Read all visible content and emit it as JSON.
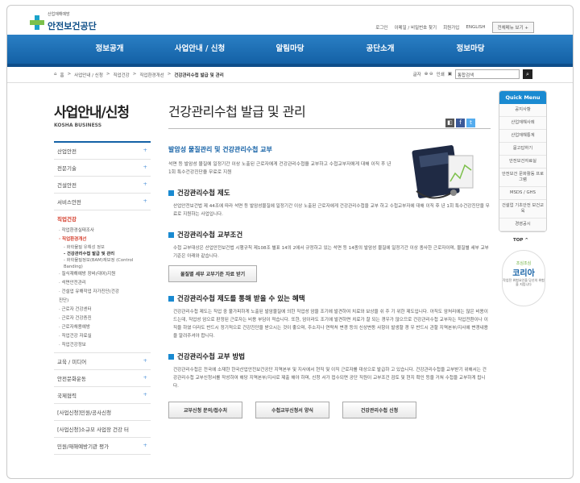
{
  "header": {
    "logo_small": "산업재해예방",
    "logo_name": "안전보건공단",
    "utils": [
      "로그인",
      "이메일 / 비밀번호 찾기",
      "회원가입",
      "ENGLISH"
    ],
    "all_menu": "전체메뉴 보기 +"
  },
  "gnb": [
    "정보공개",
    "사업안내 / 신청",
    "알림마당",
    "공단소개",
    "정보마당"
  ],
  "breadcrumb": {
    "items": [
      "홈",
      "사업안내 / 신청",
      "직업건강",
      "직업환경개선"
    ],
    "current": "건강관리수첩 발급 및 관리"
  },
  "locbar": {
    "print": "글자",
    "print_sym": "⊕ ⊖",
    "print2": "인쇄",
    "search_placeholder": "통합검색"
  },
  "sidebar": {
    "title": "사업안내/신청",
    "subtitle": "KOSHA BUSINESS",
    "items": [
      {
        "label": "산업안전",
        "plus": "+"
      },
      {
        "label": "전문기술",
        "plus": "+"
      },
      {
        "label": "건설안전",
        "plus": "+"
      },
      {
        "label": "서비스안전",
        "plus": "+"
      }
    ],
    "active": "직업건강",
    "subs": [
      {
        "label": "· 작업환경실태조사",
        "cls": ""
      },
      {
        "label": "· 직업환경개선",
        "cls": "red"
      }
    ],
    "subsubs": [
      {
        "label": "- 화학물질 유해성 정보",
        "cls": ""
      },
      {
        "label": "- 건강관리수첩 발급 및 관리",
        "cls": "cur"
      },
      {
        "label": "- 화학물질정보(BAM)재보정 (Control",
        "cls": ""
      },
      {
        "label": "Banding)",
        "cls": ""
      }
    ],
    "subs2": [
      "· 질식재해예방 장비(대여)지원",
      "· 석면안전관리",
      "· 건설업 유해작업 자가진단(건강",
      "  진단)",
      "· 근로자 건강센터",
      "· 근로자 건강증진",
      "· 근로자채용예방",
      "· 직업건강 자료실",
      "· 직업건강정보"
    ],
    "items2": [
      {
        "label": "교육 / 미디어",
        "plus": "+"
      },
      {
        "label": "안전문화운동",
        "plus": "+"
      },
      {
        "label": "국제협력",
        "plus": "+"
      },
      {
        "label": "[사업신청]민원/공사신청",
        "plus": ""
      },
      {
        "label": "[사업신청]소규모 사업장 건강 터",
        "plus": ""
      },
      {
        "label": "민원/재해예방기관 평가",
        "plus": "+"
      }
    ]
  },
  "content": {
    "title": "건강관리수첩 발급 및 관리",
    "intro_heading": "발암성 물질관리 및 건강관리수첩 교부",
    "intro_text": "석면 등 발암성 물질에 일정기간 이상 노출된 근로자에게 건강관리수첩을 교부하고 수첩교부자에게 대해 이직 후 년 1회 특수건강진단을 무료로 지원",
    "sections": [
      {
        "heading": "건강관리수첩 제도",
        "text": "산업안전보건법 제 44조에 따라 석면 등 발암성물질에 일정기간 이상 노출된 근로자에게 건강관리수첩을 교부 하고 수첩교부자에 대해 이직 후 년 1회 특수건강진단을 무료로 지원하는 사업입니다."
      },
      {
        "heading": "건강관리수첩 교부조건",
        "text": "수첩 교부대상은 산업안전보건법 시행규칙 제108조 별표 14의 2에서 규정하고 있는 석면 등 14종의 발암성 물질에 일정기간 이상 종사한 근로자이며, 물질별 세부 교부기준은 아래와 같습니다.",
        "button": "물질별 세부 교부기준 자료 받기"
      },
      {
        "heading": "건강관리수첩 제도를 통해 받을 수 있는 혜택",
        "text": "건강관리수첩 제도는 직업 중 불가피하게 노출된 발암물질에 의한 직업성 암을 조기에 발견하여 치료와 보상을 쉬 주 기 위한 제도입니다. 아직도 암처리에는 많은 비용이 드는데, 직업성 암으로 판정된 근로자는 비용 부담이 적습니다. 또한, 암이라도 조기에 발견하면 치료가 잘 되는 경우가 많으므로 건강관리수첩 교부자는 직업전환이나 이직을 하였 더라도 반드시 정기적으로 건강진단을 받으시는 것이 좋으며, 주소지나 연락처 변경 등의 신상변동 사항이 발생할 경 우 반드시 관할 지역본부/지사에 변경내용을 알려주셔야 합니다."
      },
      {
        "heading": "건강관리수첩 교부 방법",
        "text": "건강관리수첩은 전국에 소재한 한국산업안전보건공단 지역본부 및 지사에서 현직 및 이직 근로자를 대상으로 발급하 고 있습니다. 건강관리수첩을 교부받기 위해서는 건강관리수첩 교부신청서를 작성하여 해당 지역본부/지사로 제출 해야 하며, 신청 서가 접수되면 공단 직원이 교부조건 검토 및 현지 확인 등을 거쳐 수첩을 교부하게 됩니다."
      }
    ],
    "bottom_buttons": [
      "교부신청 문의/접수처",
      "수첩교부신청서 양식",
      "건강관리수첩 신청"
    ]
  },
  "quick_menu": {
    "title": "Quick Menu",
    "items": [
      "공지사항",
      "산업재해사례",
      "산업재해통계",
      "묻고답하기",
      "안전보건자료실",
      "안전보건 문화활동 프로그램",
      "MSDS / GHS",
      "건설업 기초안전 보건교육",
      "경영공시"
    ],
    "top": "TOP ^"
  },
  "badge": {
    "line1": "조심조심",
    "line2": "코리아",
    "line3": "작업전 위험요인을 당신의 위험을 지킵니다"
  }
}
